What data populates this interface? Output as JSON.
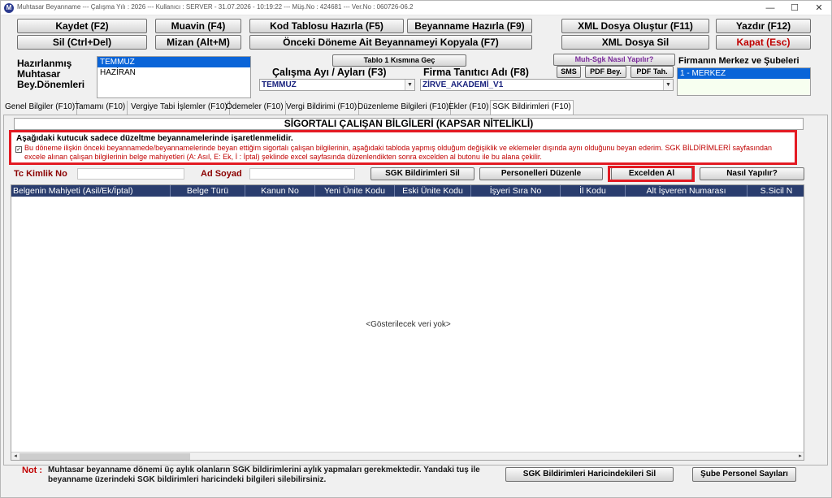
{
  "window": {
    "title": "Muhtasar Beyanname  ---  Çalışma Yılı : 2026  ---  Kullanıcı : SERVER - 31.07.2026 - 10:19:22  ---  Müş.No : 424681  ---  Ver.No : 060726-06.2",
    "minimize": "—",
    "maximize": "☐",
    "close": "✕"
  },
  "toolbar": {
    "kaydet": "Kaydet (F2)",
    "muavin": "Muavin (F4)",
    "kod_tablosu": "Kod Tablosu Hazırla (F5)",
    "beyanname_hazirla": "Beyanname Hazırla (F9)",
    "xml_olustur": "XML Dosya Oluştur (F11)",
    "yazdir": "Yazdır (F12)",
    "sil": "Sil (Ctrl+Del)",
    "mizan": "Mizan (Alt+M)",
    "onceki_kopyala": "Önceki Döneme Ait Beyannameyi Kopyala (F7)",
    "xml_sil": "XML Dosya Sil",
    "kapat": "Kapat (Esc)"
  },
  "periods": {
    "label": "Hazırlanmış Muhtasar Bey.Dönemleri",
    "label_lines": [
      "Hazırlanmış",
      "Muhtasar",
      "Bey.Dönemleri"
    ],
    "items": [
      "TEMMUZ",
      "HAZİRAN"
    ],
    "selected_index": 0
  },
  "form": {
    "tablo_button": "Tablo 1 Kısmına Geç",
    "calisma_ayi_label": "Çalışma Ayı / Ayları (F3)",
    "calisma_ayi_value": "TEMMUZ",
    "firma_label": "Firma Tanıtıcı Adı (F8)",
    "firma_value": "ZİRVE_AKADEMİ_V1",
    "muh_sgk_button": "Muh-Sgk Nasıl Yapılır?",
    "sms_button": "SMS",
    "pdf_bey_button": "PDF Bey.",
    "pdf_tah_button": "PDF Tah.",
    "sube_label": "Firmanın Merkez ve Şubeleri",
    "sube_items": [
      "1 - MERKEZ"
    ]
  },
  "tabs": [
    "Genel Bilgiler (F10)",
    "Tamamı (F10)",
    "Vergiye Tabi İşlemler (F10)",
    "Ödemeler (F10)",
    "Vergi Bildirimi (F10)",
    "Düzenleme Bilgileri (F10)",
    "Ekler (F10)",
    "SGK Bildirimleri (F10)"
  ],
  "active_tab_index": 7,
  "section": {
    "title": "SİGORTALI ÇALIŞAN BİLGİLERİ (KAPSAR NİTELİKLİ)",
    "warning_title": "Aşağıdaki kutucuk sadece düzeltme beyannamelerinde işaretlenmelidir.",
    "checkbox_mark": "✓",
    "warning_text": "Bu döneme ilişkin önceki beyannamede/beyannamelerinde beyan ettiğim sigortalı çalışan bilgilerinin, aşağıdaki tabloda yapmış olduğum değişiklik ve eklemeler dışında aynı olduğunu beyan ederim. SGK BİLDİRİMLERİ sayfasından excele alınan çalışan bilgilerinin belge mahiyetleri (A: Asıl, E: Ek, İ : İptal) şeklinde excel sayfasında düzenlendikten sonra excelden al butonu ile bu alana çekilir."
  },
  "filters": {
    "tc_label": "Tc Kimlik No",
    "tc_value": "",
    "ad_label": "Ad Soyad",
    "ad_value": "",
    "sgk_sil": "SGK Bildirimleri Sil",
    "personel_duzenle": "Personelleri Düzenle",
    "excelden_al": "Excelden Al",
    "nasil_yapilir": "Nasıl Yapılır?"
  },
  "grid": {
    "columns": [
      "Belgenin Mahiyeti (Asil/Ek/İptal)",
      "Belge Türü",
      "Kanun No",
      "Yeni Ünite Kodu",
      "Eski Ünite Kodu",
      "İşyeri Sıra No",
      "İl Kodu",
      "Alt İşveren Numarası",
      "S.Sicil N"
    ],
    "empty_message": "<Gösterilecek veri yok>",
    "scroll_left": "◂",
    "scroll_right": "▸"
  },
  "footer": {
    "note_label": "Not :",
    "note_text": "Muhtasar beyanname dönemi üç aylık olanların SGK bildirimlerini aylık yapmaları gerekmektedir. Yandaki tuş ile beyanname üzerindeki SGK bildirimleri haricindeki bilgileri silebilirsiniz.",
    "sgk_haric_sil": "SGK Bildirimleri Haricindekileri Sil",
    "sube_personel": "Şube Personel Sayıları"
  }
}
